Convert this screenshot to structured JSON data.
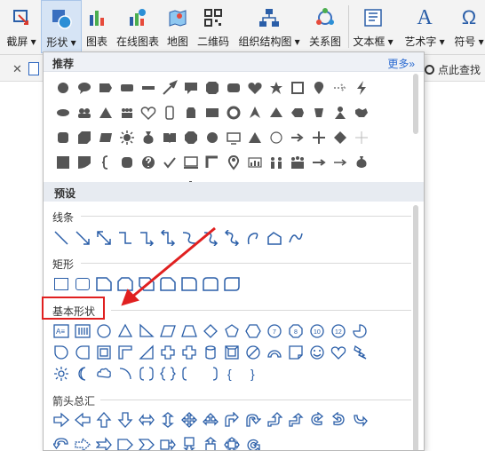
{
  "ribbon": {
    "items": [
      {
        "label": "截屏 ▾",
        "icon": "screenshot-icon"
      },
      {
        "label": "形状 ▾",
        "icon": "shapes-icon"
      },
      {
        "label": "图表",
        "icon": "bar-chart-icon"
      },
      {
        "label": "在线图表",
        "icon": "online-chart-icon"
      },
      {
        "label": "地图",
        "icon": "map-icon"
      },
      {
        "label": "二维码",
        "icon": "qrcode-icon"
      },
      {
        "label": "组织结构图 ▾",
        "icon": "org-chart-icon"
      },
      {
        "label": "关系图",
        "icon": "relation-icon"
      },
      {
        "label": "文本框 ▾",
        "icon": "textbox-icon"
      },
      {
        "label": "艺术字 ▾",
        "icon": "wordart-icon"
      },
      {
        "label": "符号 ▾",
        "icon": "omega-icon"
      }
    ],
    "glyph_A": "A",
    "glyph_omega": "Ω"
  },
  "bar2": {
    "close": "✕",
    "search": "点此查找"
  },
  "panel": {
    "recommended_title": "推荐",
    "more": "更多»",
    "preset_title": "预设",
    "line_label": "线条",
    "rect_label": "矩形",
    "basic_label": "基本形状",
    "arrow_label": "箭头总汇",
    "basic_text_box": "A≡",
    "num_labels": [
      "7",
      "8",
      "10",
      "12"
    ],
    "bracket_glyphs": [
      "{",
      "}"
    ]
  },
  "colors": {
    "accent": "#2a5ea8",
    "highlight": "#e02020",
    "rec_icon": "#555555"
  }
}
